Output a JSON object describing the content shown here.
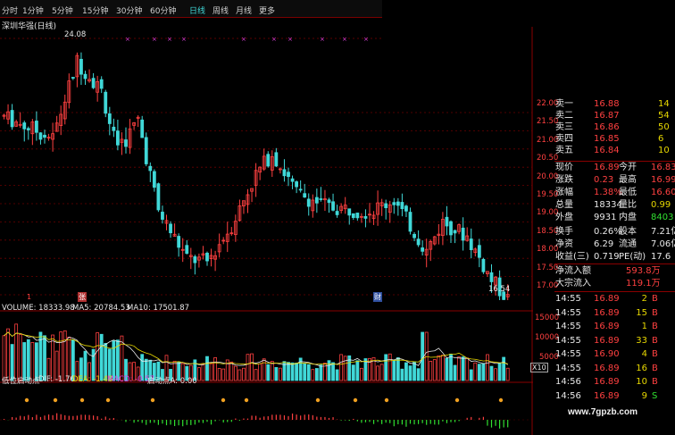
{
  "periods": [
    "分时",
    "1分钟",
    "5分钟",
    "15分钟",
    "30分钟",
    "60分钟",
    "日线",
    "周线",
    "月线",
    "更多"
  ],
  "active_period": "日线",
  "stock_title": "深圳华强(日线)",
  "colors": {
    "up": "#ff4040",
    "down": "#40d8d8",
    "grid": "#7a0000",
    "axis_text": "#ff4040",
    "text": "#e8e8e8",
    "accent_yellow": "#e8d800"
  },
  "price_axis": [
    "22.00",
    "21.50",
    "21.00",
    "20.50",
    "20.00",
    "19.50",
    "19.00",
    "18.50",
    "18.00",
    "17.50",
    "17.00"
  ],
  "high_marker": "24.08",
  "low_marker": "16.54",
  "event_markers": [
    "1",
    "张",
    "财"
  ],
  "volume": {
    "label": "VOLUME: 18333.98",
    "ma5": "MA5: 20784.53",
    "ma10": "MA10: 17501.87",
    "axis": [
      "15000",
      "10000",
      "5000"
    ],
    "unit": "X10"
  },
  "macd": {
    "label": "低位启动点",
    "dif": "DIF: -1.76",
    "dea": "DEA: -1.48",
    "macd": "MACD: -0.57",
    "signal": "启动点A: 0.00"
  },
  "quote": {
    "sell": [
      {
        "label": "卖一",
        "price": "16.88",
        "vol": "14"
      },
      {
        "label": "卖二",
        "price": "16.87",
        "vol": "54"
      },
      {
        "label": "卖三",
        "price": "16.86",
        "vol": "50"
      },
      {
        "label": "卖四",
        "price": "16.85",
        "vol": "6"
      },
      {
        "label": "卖五",
        "price": "16.84",
        "vol": "10"
      }
    ],
    "info": [
      {
        "l1": "现价",
        "v1": "16.89",
        "l2": "今开",
        "v2": "16.83"
      },
      {
        "l1": "涨跌",
        "v1": "0.23",
        "l2": "最高",
        "v2": "16.99"
      },
      {
        "l1": "涨幅",
        "v1": "1.38%",
        "l2": "最低",
        "v2": "16.60"
      },
      {
        "l1": "总量",
        "v1": "18334",
        "l2": "量比",
        "v2": "0.99"
      },
      {
        "l1": "外盘",
        "v1": "9931",
        "l2": "内盘",
        "v2": "8403"
      },
      {
        "l1": "换手",
        "v1": "0.26%",
        "l2": "股本",
        "v2": "7.21亿"
      },
      {
        "l1": "净资",
        "v1": "6.29",
        "l2": "流通",
        "v2": "7.06亿"
      },
      {
        "l1": "收益(三)",
        "v1": "0.719",
        "l2": "PE(动)",
        "v2": "17.6"
      }
    ],
    "flow": [
      {
        "label": "净流入额",
        "value": "593.8万"
      },
      {
        "label": "大宗流入",
        "value": "119.1万"
      }
    ],
    "ticks": [
      {
        "time": "14:55",
        "price": "16.89",
        "vol": "2",
        "dir": "B"
      },
      {
        "time": "14:55",
        "price": "16.89",
        "vol": "15",
        "dir": "B"
      },
      {
        "time": "14:55",
        "price": "16.89",
        "vol": "1",
        "dir": "B"
      },
      {
        "time": "14:55",
        "price": "16.89",
        "vol": "33",
        "dir": "B"
      },
      {
        "time": "14:55",
        "price": "16.90",
        "vol": "4",
        "dir": "B"
      },
      {
        "time": "14:55",
        "price": "16.89",
        "vol": "16",
        "dir": "B"
      },
      {
        "time": "14:56",
        "price": "16.89",
        "vol": "10",
        "dir": "B"
      },
      {
        "time": "14:56",
        "price": "16.89",
        "vol": "9",
        "dir": "S"
      }
    ]
  },
  "watermark": "www.7gpzb.com",
  "chart_data": {
    "type": "candlestick",
    "title": "深圳华强(日线)",
    "ylim": [
      16.5,
      24.2
    ],
    "high_label": 24.08,
    "low_label": 16.54,
    "last_close": 16.89,
    "price_ticks": [
      22.0,
      21.5,
      21.0,
      20.5,
      20.0,
      19.5,
      19.0,
      18.5,
      18.0,
      17.5,
      17.0
    ],
    "volume_ticks": [
      15000,
      10000,
      5000
    ]
  }
}
